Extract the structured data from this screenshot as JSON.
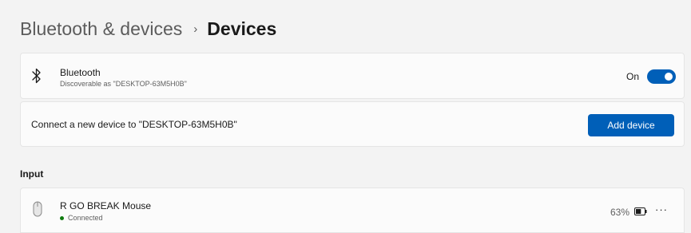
{
  "breadcrumb": {
    "parent": "Bluetooth & devices",
    "separator": "›",
    "current": "Devices"
  },
  "bluetooth": {
    "icon": "bluetooth-icon",
    "title": "Bluetooth",
    "subtitle": "Discoverable as \"DESKTOP-63M5H0B\"",
    "toggle_label": "On",
    "toggle_state": true
  },
  "add_device": {
    "text": "Connect a new device to \"DESKTOP-63M5H0B\"",
    "button_label": "Add device"
  },
  "input_section": {
    "title": "Input",
    "devices": [
      {
        "icon": "mouse-icon",
        "name": "R GO BREAK Mouse",
        "status": "Connected",
        "battery": "63%",
        "more": "···"
      }
    ]
  },
  "colors": {
    "accent": "#005fb8",
    "connected": "#0f7b0f"
  }
}
